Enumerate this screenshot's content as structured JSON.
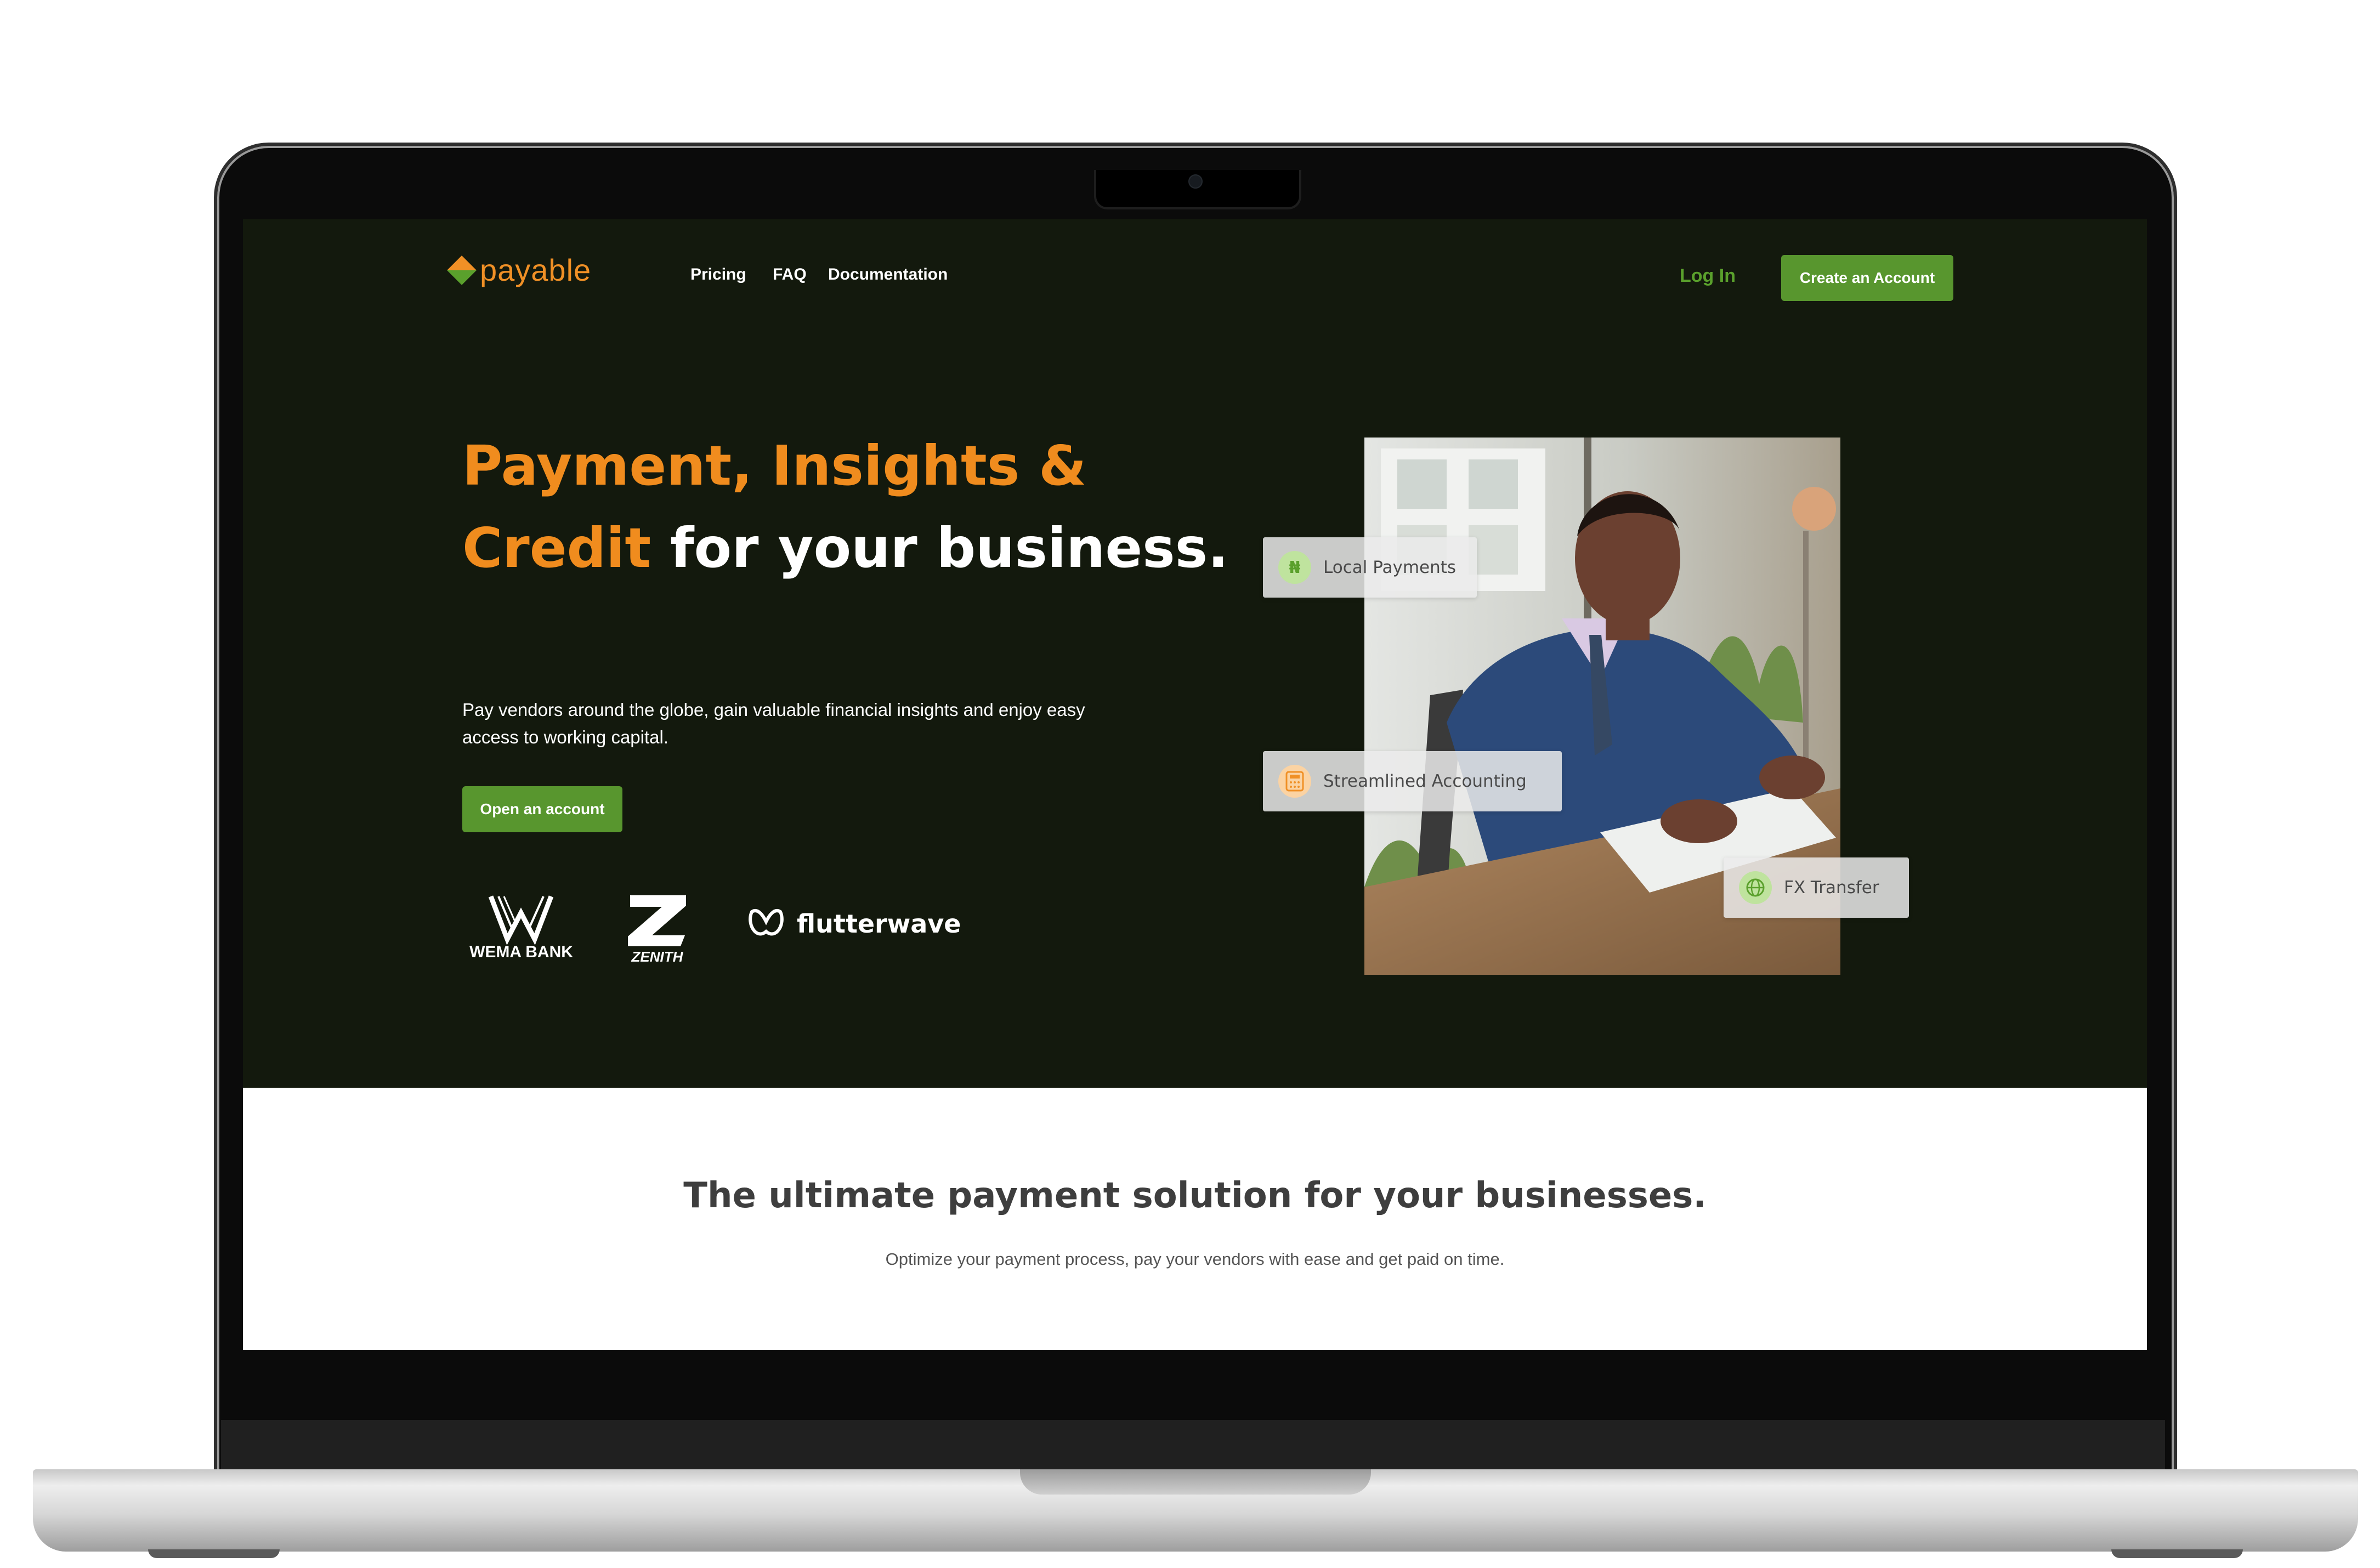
{
  "colors": {
    "hero_bg": "#13190d",
    "brand_orange": "#f08c1e",
    "brand_green": "#58962e",
    "section_bg": "#ffffff"
  },
  "header": {
    "logo": "payable",
    "nav": [
      "Pricing",
      "FAQ",
      "Documentation"
    ],
    "login": "Log In",
    "create_account": "Create an Account"
  },
  "hero": {
    "headline_orange": "Payment, Insights & Credit",
    "headline_white": " for your business.",
    "subtitle": "Pay vendors around the globe, gain valuable financial insights and enjoy easy access to working capital.",
    "cta": "Open an account",
    "partners": [
      "WEMA BANK",
      "ZENITH",
      "flutterwave"
    ],
    "feature_chips": [
      {
        "label": "Local Payments",
        "icon": "naira-icon",
        "glyph": "₦"
      },
      {
        "label": "Streamlined Accounting",
        "icon": "calculator-icon"
      },
      {
        "label": "FX Transfer",
        "icon": "globe-icon"
      }
    ]
  },
  "section": {
    "title": "The ultimate payment solution for your businesses.",
    "subtitle": "Optimize your payment process, pay your vendors with ease and get paid on time."
  }
}
